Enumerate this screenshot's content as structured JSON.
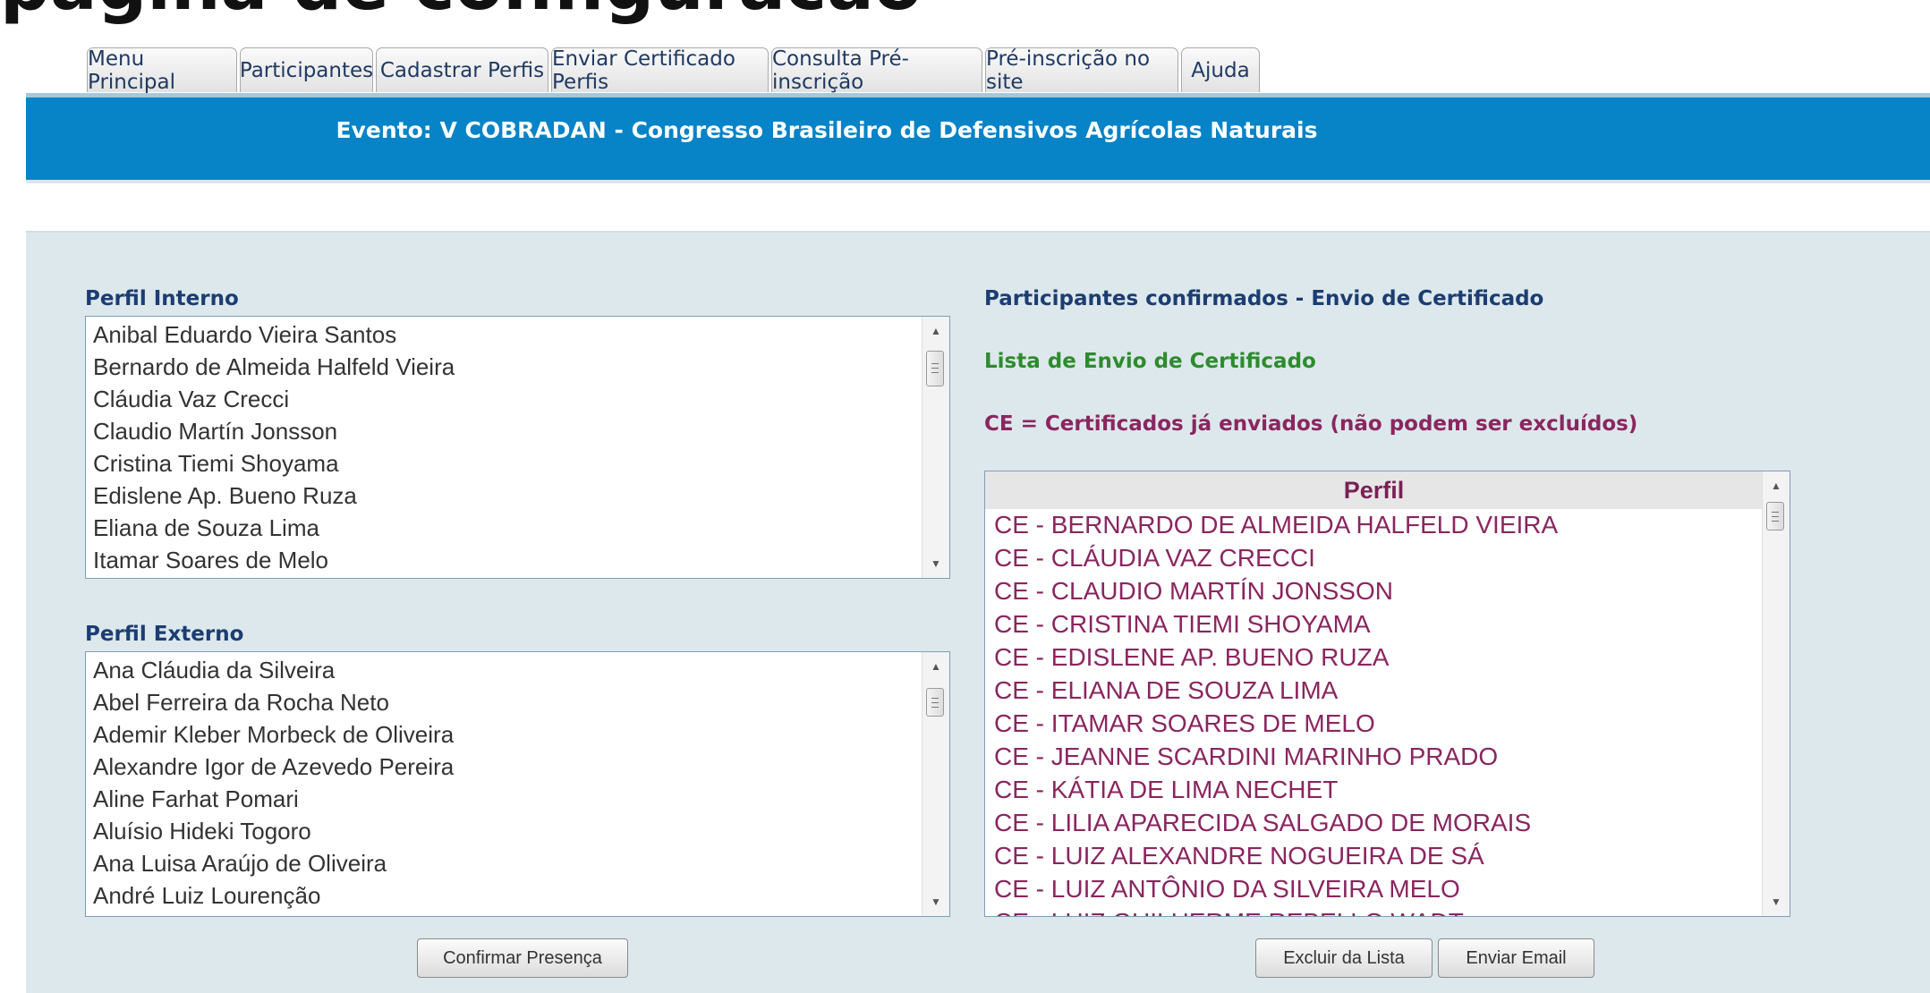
{
  "top_fragment": "pagina de configuracao",
  "tabs": [
    {
      "label": "Menu Principal"
    },
    {
      "label": "Participantes"
    },
    {
      "label": "Cadastrar Perfis"
    },
    {
      "label": "Enviar Certificado Perfis"
    },
    {
      "label": "Consulta Pré-inscrição"
    },
    {
      "label": "Pré-inscrição no site"
    },
    {
      "label": "Ajuda"
    }
  ],
  "event_title": "Evento: V COBRADAN - Congresso Brasileiro de Defensivos Agrícolas Naturais",
  "perfil_interno": {
    "label": "Perfil Interno",
    "items": [
      "Anibal Eduardo Vieira Santos",
      "Bernardo de Almeida Halfeld Vieira",
      "Cláudia Vaz Crecci",
      "Claudio Martín Jonsson",
      "Cristina Tiemi Shoyama",
      "Edislene Ap. Bueno Ruza",
      "Eliana de Souza Lima",
      "Itamar Soares de Melo"
    ]
  },
  "perfil_externo": {
    "label": "Perfil Externo",
    "items": [
      "Ana Cláudia da Silveira",
      "Abel Ferreira da Rocha Neto",
      "Ademir Kleber Morbeck de Oliveira",
      "Alexandre Igor de Azevedo Pereira",
      "Aline Farhat Pomari",
      "Aluísio Hideki Togoro",
      "Ana Luisa Araújo de Oliveira",
      "André Luiz Lourenção"
    ]
  },
  "confirmar_button": "Confirmar Presença",
  "right": {
    "title": "Participantes confirmados - Envio de Certificado",
    "lista_label": "Lista de Envio de Certificado",
    "ce_note": "CE = Certificados já enviados (não podem ser excluídos)",
    "column_header": "Perfil",
    "items": [
      "CE - BERNARDO DE ALMEIDA HALFELD VIEIRA",
      "CE - CLÁUDIA VAZ CRECCI",
      "CE - CLAUDIO MARTÍN JONSSON",
      "CE - CRISTINA TIEMI SHOYAMA",
      "CE - EDISLENE AP. BUENO RUZA",
      "CE - ELIANA DE SOUZA LIMA",
      "CE - ITAMAR SOARES DE MELO",
      "CE - JEANNE SCARDINI MARINHO PRADO",
      "CE - KÁTIA DE LIMA NECHET",
      "CE - LILIA APARECIDA SALGADO DE MORAIS",
      "CE - LUIZ ALEXANDRE NOGUEIRA DE SÁ",
      "CE - LUIZ ANTÔNIO DA SILVEIRA MELO",
      "CE - LUIZ GUILHERME REBELLO WADT"
    ],
    "excluir_button": "Excluir da Lista",
    "enviar_button": "Enviar Email"
  },
  "colors": {
    "event_bar": "#0783c7",
    "label_blue": "#1b3d73",
    "label_green": "#2e8b2e",
    "label_purple": "#8a2660",
    "panel": "#dde8ec"
  },
  "icons": {
    "scroll_up": "triangle-up",
    "scroll_down": "triangle-down"
  }
}
